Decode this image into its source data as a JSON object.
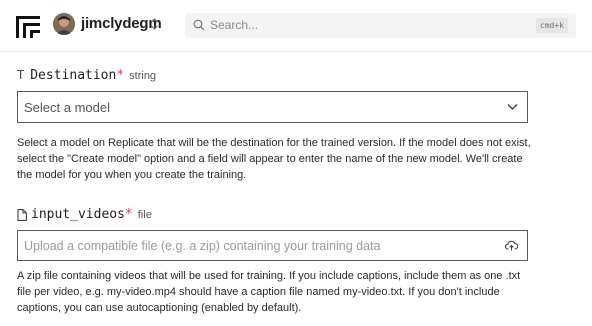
{
  "header": {
    "username": "jimclydegm",
    "search_placeholder": "Search...",
    "search_shortcut": "cmd+k",
    "icons": {
      "logo": "replicate-logo-icon",
      "avatar": "user-avatar",
      "switch": "chevron-up-down-icon",
      "search": "search-icon"
    }
  },
  "destination": {
    "type_glyph": "T",
    "name": "Destination",
    "required_mark": "*",
    "type": "string",
    "select_value": "Select a model",
    "help": "Select a model on Replicate that will be the destination for the trained version. If the model does not exist, select the \"Create model\" option and a field will appear to enter the name of the new model. We'll create the model for you when you create the training.",
    "icons": {
      "type": "text-type-icon",
      "chevron": "chevron-down-icon"
    }
  },
  "input_videos": {
    "name": "input_videos",
    "required_mark": "*",
    "type": "file",
    "placeholder": "Upload a compatible file (e.g. a zip) containing your training data",
    "help": "A zip file containing videos that will be used for training. If you include captions, include them as one .txt file per video, e.g. my-video.mp4 should have a caption file named my-video.txt. If you don't include captions, you can use autocaptioning (enabled by default).",
    "icons": {
      "type": "file-icon",
      "upload": "cloud-upload-icon"
    }
  }
}
